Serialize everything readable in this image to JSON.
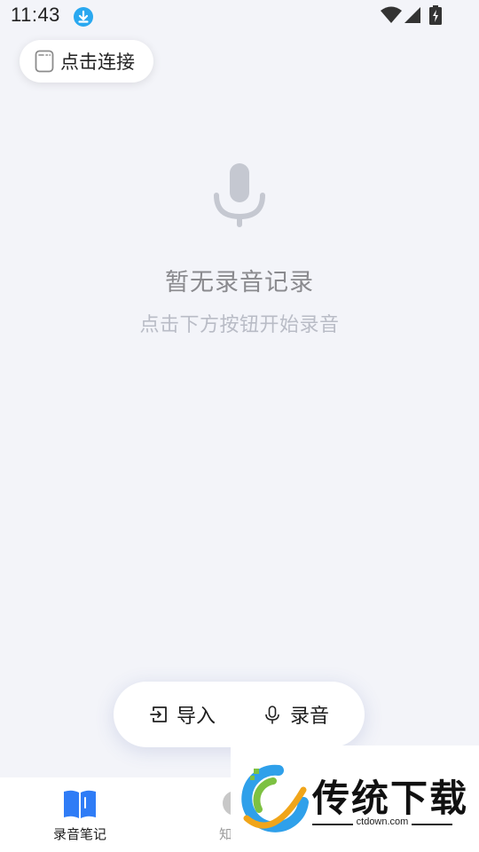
{
  "status_bar": {
    "time": "11:43",
    "icons": [
      "download-icon",
      "wifi-icon",
      "signal-icon",
      "battery-icon"
    ]
  },
  "connect": {
    "label": "点击连接",
    "icon": "device-icon"
  },
  "empty_state": {
    "icon": "microphone-icon",
    "title": "暂无录音记录",
    "subtitle": "点击下方按钮开始录音"
  },
  "actions": {
    "import_label": "导入",
    "record_label": "录音"
  },
  "bottom_nav": {
    "items": [
      {
        "label": "录音笔记",
        "icon": "book-icon",
        "active": true
      },
      {
        "label": "知",
        "icon": "knowledge-icon",
        "active": false
      }
    ]
  },
  "watermark": {
    "brand": "传统下载",
    "domain": "ctdown.com"
  },
  "colors": {
    "background": "#f3f4f9",
    "accent": "#2f7cf6",
    "download_badge": "#29a8f0"
  }
}
